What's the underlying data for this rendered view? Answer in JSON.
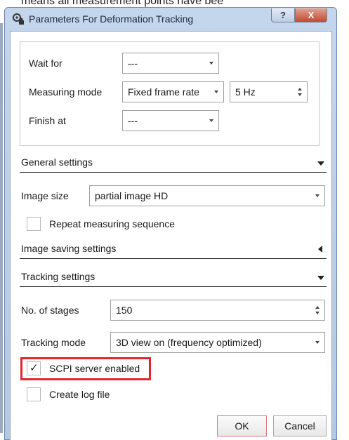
{
  "top_fragment": "means all measurement points have bee",
  "window": {
    "title": "Parameters For Deformation Tracking",
    "help_label": "?",
    "close_label": "X"
  },
  "measurement": {
    "wait_for": {
      "label": "Wait for",
      "value": "---"
    },
    "measuring_mode": {
      "label": "Measuring mode",
      "value": "Fixed frame rate",
      "rate": "5 Hz"
    },
    "finish_at": {
      "label": "Finish at",
      "value": "---"
    }
  },
  "general_settings": {
    "header": "General settings",
    "image_size": {
      "label": "Image size",
      "value": "partial image HD"
    },
    "repeat": {
      "label": "Repeat measuring sequence",
      "checked": false
    }
  },
  "image_saving": {
    "header": "Image saving settings"
  },
  "tracking": {
    "header": "Tracking settings",
    "stages": {
      "label": "No. of stages",
      "value": "150"
    },
    "mode": {
      "label": "Tracking mode",
      "value": "3D view on (frequency optimized)"
    },
    "scpi": {
      "label": "SCPI server enabled",
      "checked": true,
      "checkmark": "✓"
    },
    "log": {
      "label": "Create log file",
      "checked": false
    }
  },
  "footer": {
    "ok_label": "OK",
    "cancel_label": "Cancel"
  },
  "colors": {
    "highlight": "#e3252d",
    "close": "#c24a32",
    "titlebar": "#c4d6ec"
  }
}
